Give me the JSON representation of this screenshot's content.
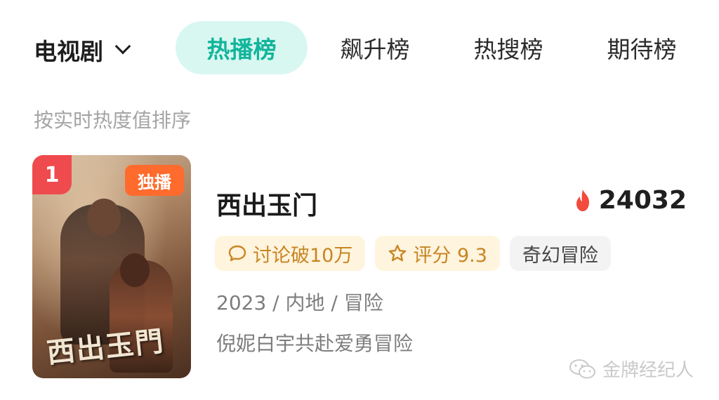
{
  "header": {
    "category_label": "电视剧",
    "tabs": [
      {
        "label": "热播榜",
        "active": true
      },
      {
        "label": "飙升榜",
        "active": false
      },
      {
        "label": "热搜榜",
        "active": false
      },
      {
        "label": "期待榜",
        "active": false
      }
    ]
  },
  "sort_note": "按实时热度值排序",
  "items": [
    {
      "rank": "1",
      "badge": "独播",
      "poster_title": "西出玉門",
      "title": "西出玉门",
      "heat_value": "24032",
      "tags": [
        {
          "label": "讨论破10万",
          "icon": "chat-bubble-icon"
        },
        {
          "label": "评分 9.3",
          "icon": "star-icon"
        },
        {
          "label": "奇幻冒险"
        }
      ],
      "meta": "2023 / 内地 / 冒险",
      "description": "倪妮白宇共赴爱勇冒险"
    }
  ],
  "watermark": "金牌经纪人",
  "colors": {
    "accent": "#12b59b",
    "active_tab_bg": "#d9f7f1",
    "rank_badge": "#ef4a4d",
    "exclusive_badge": "#ff6b2c",
    "heat_flame": "#f24a3d",
    "warm_tag_text": "#c88524",
    "warm_tag_bg": "#fff4dd"
  }
}
